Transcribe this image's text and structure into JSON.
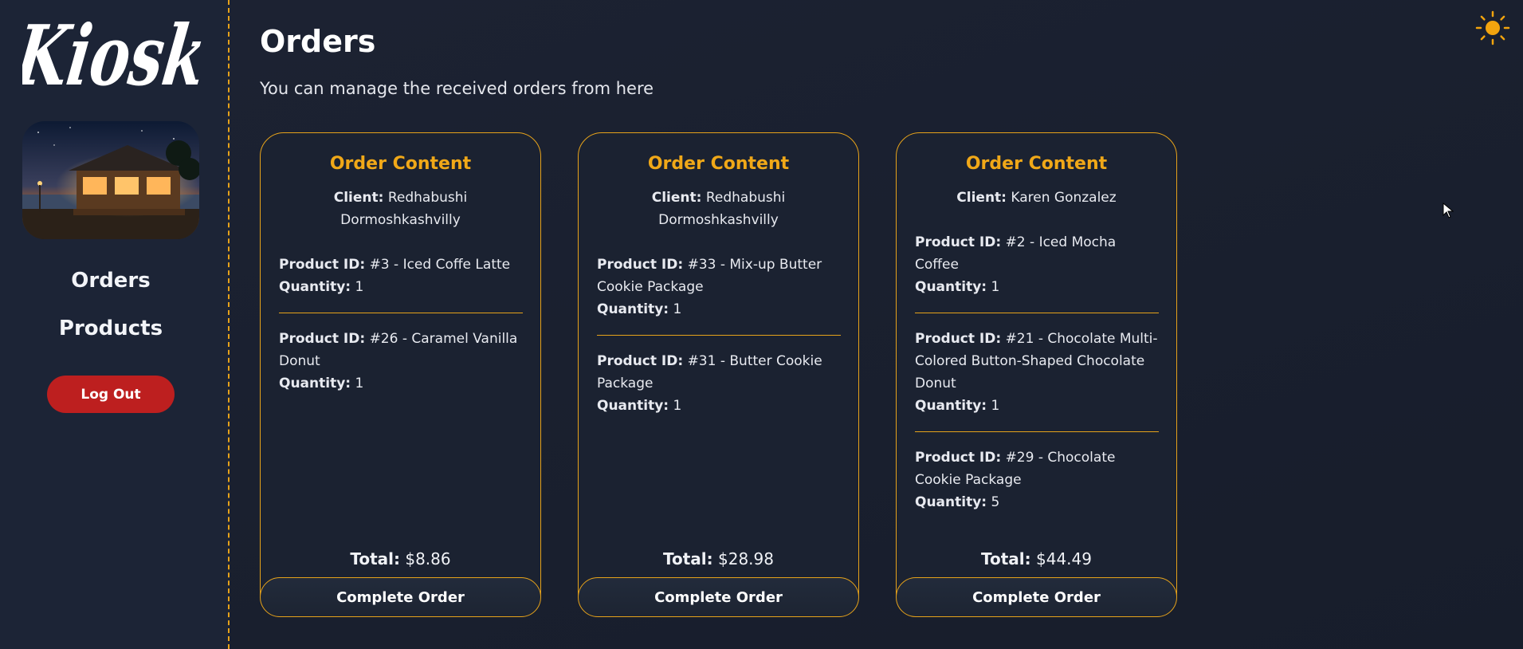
{
  "sidebar": {
    "logo_text": "Kiosk",
    "store_image": "kiosk-storefront-at-night",
    "nav": [
      {
        "label": "Orders"
      },
      {
        "label": "Products"
      }
    ],
    "logout_label": "Log Out"
  },
  "header": {
    "title": "Orders",
    "subtitle": "You can manage the received orders from here",
    "theme_icon": "sun-icon"
  },
  "labels": {
    "card_title": "Order Content",
    "client": "Client:",
    "product_id": "Product ID:",
    "quantity": "Quantity:",
    "total": "Total:",
    "complete": "Complete Order"
  },
  "orders": [
    {
      "client": "Redhabushi Dormoshkashvilly",
      "items": [
        {
          "product": "#3 - Iced Coffe Latte",
          "quantity": "1"
        },
        {
          "product": "#26 - Caramel Vanilla Donut",
          "quantity": "1"
        }
      ],
      "total": "$8.86"
    },
    {
      "client": "Redhabushi Dormoshkashvilly",
      "items": [
        {
          "product": "#33 - Mix-up Butter Cookie Package",
          "quantity": "1"
        },
        {
          "product": "#31 - Butter Cookie Package",
          "quantity": "1"
        }
      ],
      "total": "$28.98"
    },
    {
      "client": "Karen Gonzalez",
      "items": [
        {
          "product": "#2 - Iced Mocha Coffee",
          "quantity": "1"
        },
        {
          "product": "#21 - Chocolate Multi-Colored Button-Shaped Chocolate Donut",
          "quantity": "1"
        },
        {
          "product": "#29 - Chocolate Cookie Package",
          "quantity": "5"
        }
      ],
      "total": "$44.49"
    }
  ],
  "colors": {
    "accent": "#e6a21a",
    "title_accent": "#f0a818",
    "logout": "#bd1f1f",
    "background": "#1a2130"
  }
}
